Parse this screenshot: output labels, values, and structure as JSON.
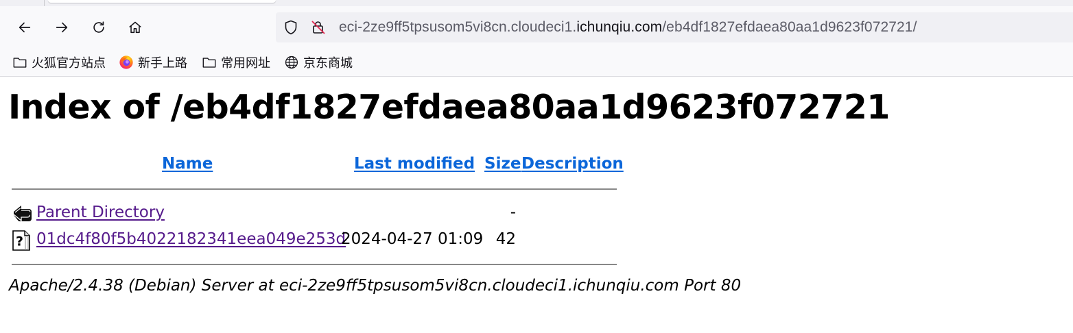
{
  "browser": {
    "url": {
      "prefix": "eci-2ze9ff5tpsusom5vi8cn.cloudeci1.",
      "domain": "ichunqiu.com",
      "path": "/eb4df1827efdaea80aa1d9623f072721/"
    },
    "bookmarks": [
      {
        "label": "火狐官方站点",
        "icon": "folder-icon"
      },
      {
        "label": "新手上路",
        "icon": "firefox-icon"
      },
      {
        "label": "常用网址",
        "icon": "folder-icon"
      },
      {
        "label": "京东商城",
        "icon": "globe-icon"
      }
    ]
  },
  "page": {
    "title": "Index of /eb4df1827efdaea80aa1d9623f072721",
    "columns": {
      "name": "Name",
      "last_modified": "Last modified",
      "size": "Size",
      "description": "Description"
    },
    "rows": [
      {
        "icon": "back-folder-icon",
        "name": "Parent Directory",
        "modified": "",
        "size": "-",
        "description": ""
      },
      {
        "icon": "unknown-file-icon",
        "name": "01dc4f80f5b4022182341eea049e253d",
        "modified": "2024-04-27 01:09",
        "size": "42",
        "description": ""
      }
    ],
    "server_signature": "Apache/2.4.38 (Debian) Server at eci-2ze9ff5tpsusom5vi8cn.cloudeci1.ichunqiu.com Port 80"
  },
  "colors": {
    "link": "#0b66d9",
    "visited_link": "#551a8b",
    "toolbar_bg": "#f9f9fb",
    "urlbar_bg": "#f0f0f4"
  }
}
